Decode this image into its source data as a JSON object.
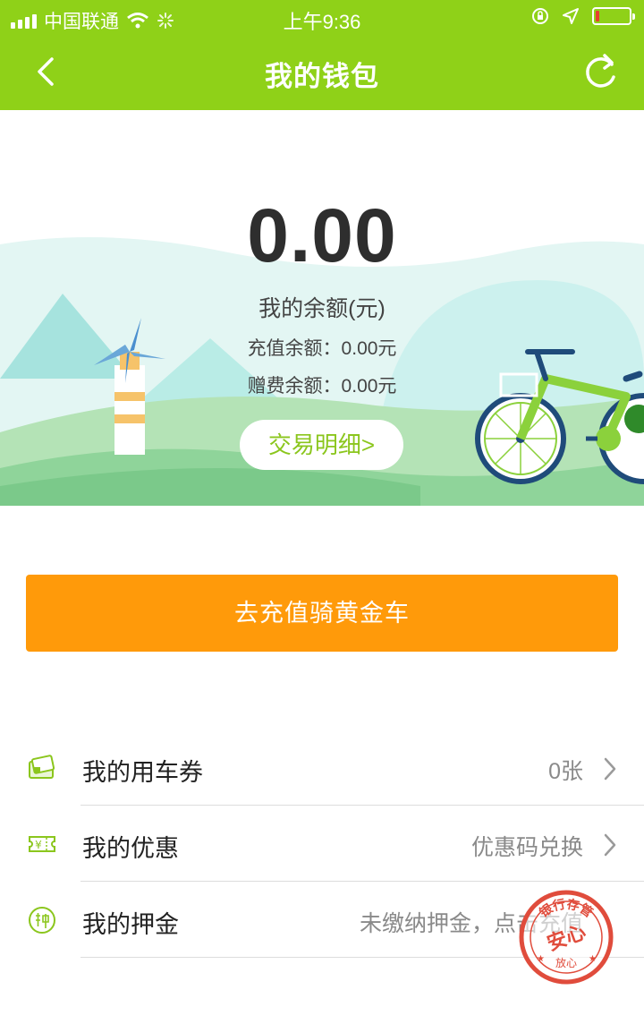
{
  "status_bar": {
    "carrier": "中国联通",
    "time": "上午9:36",
    "battery_fraction": 0.12
  },
  "header": {
    "title": "我的钱包",
    "back_icon": "chevron-left-icon",
    "refresh_icon": "refresh-icon"
  },
  "wallet": {
    "balance": "0.00",
    "balance_label": "我的余额(元)",
    "recharge_line": "充值余额：0.00元",
    "gift_line": "赠费余额：0.00元",
    "detail_button": "交易明细>"
  },
  "recharge_button": "去充值骑黄金车",
  "menu": [
    {
      "label": "我的用车券",
      "value": "0张",
      "icon": "ticket-icon"
    },
    {
      "label": "我的优惠",
      "value": "优惠码兑换",
      "icon": "coupon-icon"
    },
    {
      "label": "我的押金",
      "value": "未缴纳押金，点击充值",
      "icon": "deposit-icon"
    }
  ],
  "stamp": {
    "top_text": "银行存管",
    "center_text": "安心",
    "bottom_text": "放心"
  },
  "colors": {
    "header_green": "#8fd118",
    "accent_orange": "#ff9a0a",
    "detail_green": "#8bc61d"
  }
}
